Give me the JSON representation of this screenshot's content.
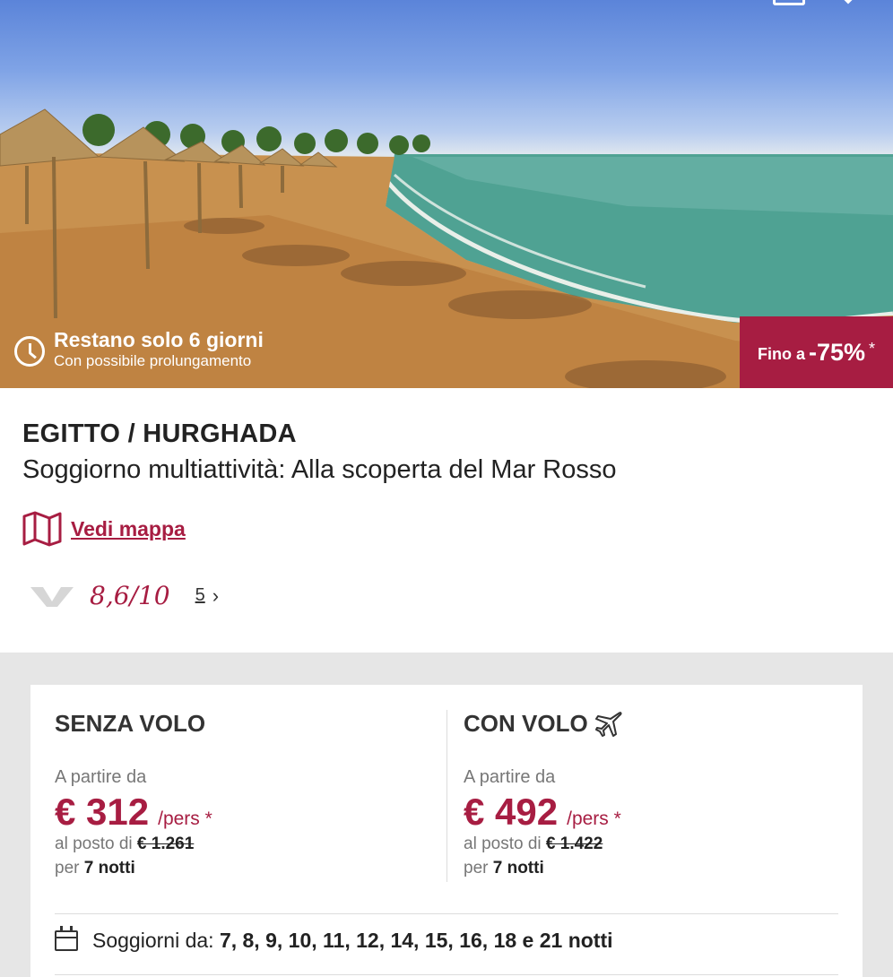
{
  "hero": {
    "remaining_title": "Restano solo 6 giorni",
    "remaining_subtitle": "Con possibile prolungamento",
    "discount_label": "Fino a",
    "discount_value": "-75%",
    "discount_star": "*"
  },
  "offer": {
    "location": "EGITTO / HURGHADA",
    "title": "Soggiorno multiattività: Alla scoperta del Mar Rosso",
    "map_link": "Vedi mappa",
    "rating": "8,6/10",
    "reviews_count": "5"
  },
  "prices": {
    "without_flight": {
      "heading": "SENZA VOLO",
      "from_label": "A partire da",
      "price": "€ 312",
      "per": "/pers *",
      "instead_label": "al posto di",
      "old_price": "€ 1.261",
      "per_label": "per",
      "nights": "7 notti"
    },
    "with_flight": {
      "heading": "CON VOLO",
      "from_label": "A partire da",
      "price": "€ 492",
      "per": "/pers *",
      "instead_label": "al posto di",
      "old_price": "€ 1.422",
      "per_label": "per",
      "nights": "7 notti"
    }
  },
  "stays": {
    "label": "Soggiorni da:",
    "values": "7, 8, 9, 10, 11, 12, 14, 15, 16, 18 e 21 notti"
  },
  "colors": {
    "accent": "#a71d42",
    "background_grey": "#e6e6e6"
  }
}
